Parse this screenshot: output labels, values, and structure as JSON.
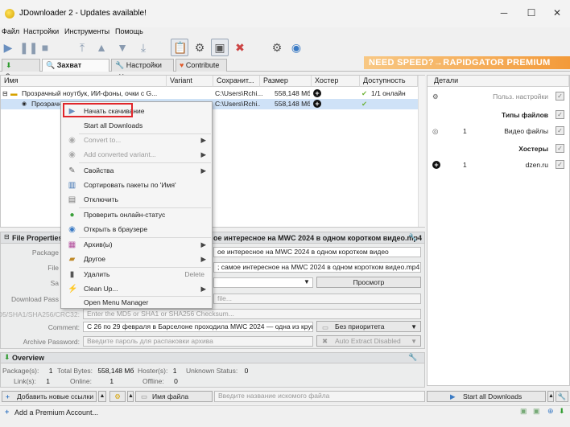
{
  "window": {
    "title": "JDownloader 2 - Updates available!",
    "controls": {
      "minimize": "─",
      "maximize": "☐",
      "close": "✕"
    }
  },
  "menu": [
    "Файл",
    "Настройки",
    "Инструменты",
    "Помощь"
  ],
  "tabs": [
    {
      "label": "Закачка"
    },
    {
      "label": "Захват ссылок"
    },
    {
      "label": "Настройки"
    },
    {
      "label": "Contribute"
    }
  ],
  "banner": "NEED SPEED?→RAPIDGATOR PREMIUM",
  "table": {
    "headers": [
      "Имя",
      "Variant",
      "Сохранит...",
      "Размер",
      "Хостер",
      "Доступность"
    ],
    "rows": [
      {
        "name": "Прозрачный ноутбук, ИИ-фоны, очки с G...",
        "variant": "",
        "save": "C:\\Users\\Rchi... [1]",
        "size": "558,148 Мб",
        "host": "+",
        "avail": "1/1 онлайн"
      },
      {
        "name": "Прозрачн",
        "variant": "",
        "save": "C:\\Users\\Rchi...",
        "size": "558,148 Мб",
        "host": "+",
        "avail": ""
      }
    ]
  },
  "right_panel": {
    "header": "Детали",
    "user_settings": "Польз. настройки",
    "file_types_header": "Типы файлов",
    "file_types": [
      {
        "count": "1",
        "label": "Видео файлы"
      }
    ],
    "hosters_header": "Хостеры",
    "hosters": [
      {
        "count": "1",
        "label": "dzen.ru"
      }
    ]
  },
  "context_menu": {
    "items": [
      {
        "label": "Начать скачивание",
        "icon": "play-icon",
        "disabled": false
      },
      {
        "label": "Start all Downloads",
        "icon": "",
        "disabled": false
      },
      {
        "label": "Convert to...",
        "icon": "convert-icon",
        "disabled": true,
        "submenu": true
      },
      {
        "label": "Add converted variant...",
        "icon": "variant-icon",
        "disabled": true,
        "submenu": true
      },
      {
        "label": "Свойства",
        "icon": "wrench-icon",
        "disabled": false,
        "submenu": true
      },
      {
        "label": "Сортировать пакеты по 'Имя'",
        "icon": "sort-icon",
        "disabled": false
      },
      {
        "label": "Отключить",
        "icon": "disable-icon",
        "disabled": false
      },
      {
        "label": "Проверить онлайн-статус",
        "icon": "check-online-icon",
        "disabled": false
      },
      {
        "label": "Открыть в браузере",
        "icon": "browser-icon",
        "disabled": false
      },
      {
        "label": "Архив(ы)",
        "icon": "archive-icon",
        "disabled": false,
        "submenu": true
      },
      {
        "label": "Другое",
        "icon": "other-icon",
        "disabled": false,
        "submenu": true
      },
      {
        "label": "Удалить",
        "icon": "trash-icon",
        "disabled": false,
        "shortcut": "Delete"
      },
      {
        "label": "Clean Up...",
        "icon": "broom-icon",
        "disabled": false,
        "submenu": true
      },
      {
        "label": "Open Menu Manager",
        "icon": "",
        "disabled": false
      }
    ]
  },
  "properties": {
    "header": "File Properties:",
    "header_title": "ое интересное на MWC 2024 в одном коротком видео.mp4",
    "labels": {
      "package": "Package",
      "file": "File",
      "save": "Sa",
      "download_pass": "Download Pass",
      "hashes": "MD5/SHA1/SHA256/CRC32:",
      "comment": "Comment:",
      "archive_password": "Archive Password:"
    },
    "package_value": "ое интересное на MWC 2024 в одном коротком видео",
    "file_value": "; самое интересное на MWC 2024 в одном коротком видео.mp4",
    "save_value": "",
    "browse_button": "Просмотр",
    "download_pass_placeholder": "file...",
    "hash_placeholder": "Enter the MD5 or SHA1 or SHA256 Checksum...",
    "comment_value": "С 26 по 29 февраля в Барселоне проходила MWC 2024 — одна из крупнейших",
    "priority": "Без приоритета",
    "archive_placeholder": "Введите пароль для распаковки архива",
    "auto_extract": "Auto Extract Disabled"
  },
  "overview": {
    "header": "Overview",
    "packages_label": "Package(s):",
    "packages": "1",
    "total_bytes_label": "Total Bytes:",
    "total_bytes": "558,148 Мб",
    "hosters_label": "Hoster(s):",
    "hosters": "1",
    "unknown_label": "Unknown Status:",
    "unknown": "0",
    "links_label": "Link(s):",
    "links": "1",
    "online_label": "Online:",
    "online": "1",
    "offline_label": "Offline:",
    "offline": "0"
  },
  "bottom": {
    "add_links": "Добавить новые ссылки",
    "filename_option": "Имя файла",
    "search_placeholder": "Введите название искомого файла",
    "start_all": "Start all Downloads",
    "premium": "Add a Premium Account..."
  }
}
